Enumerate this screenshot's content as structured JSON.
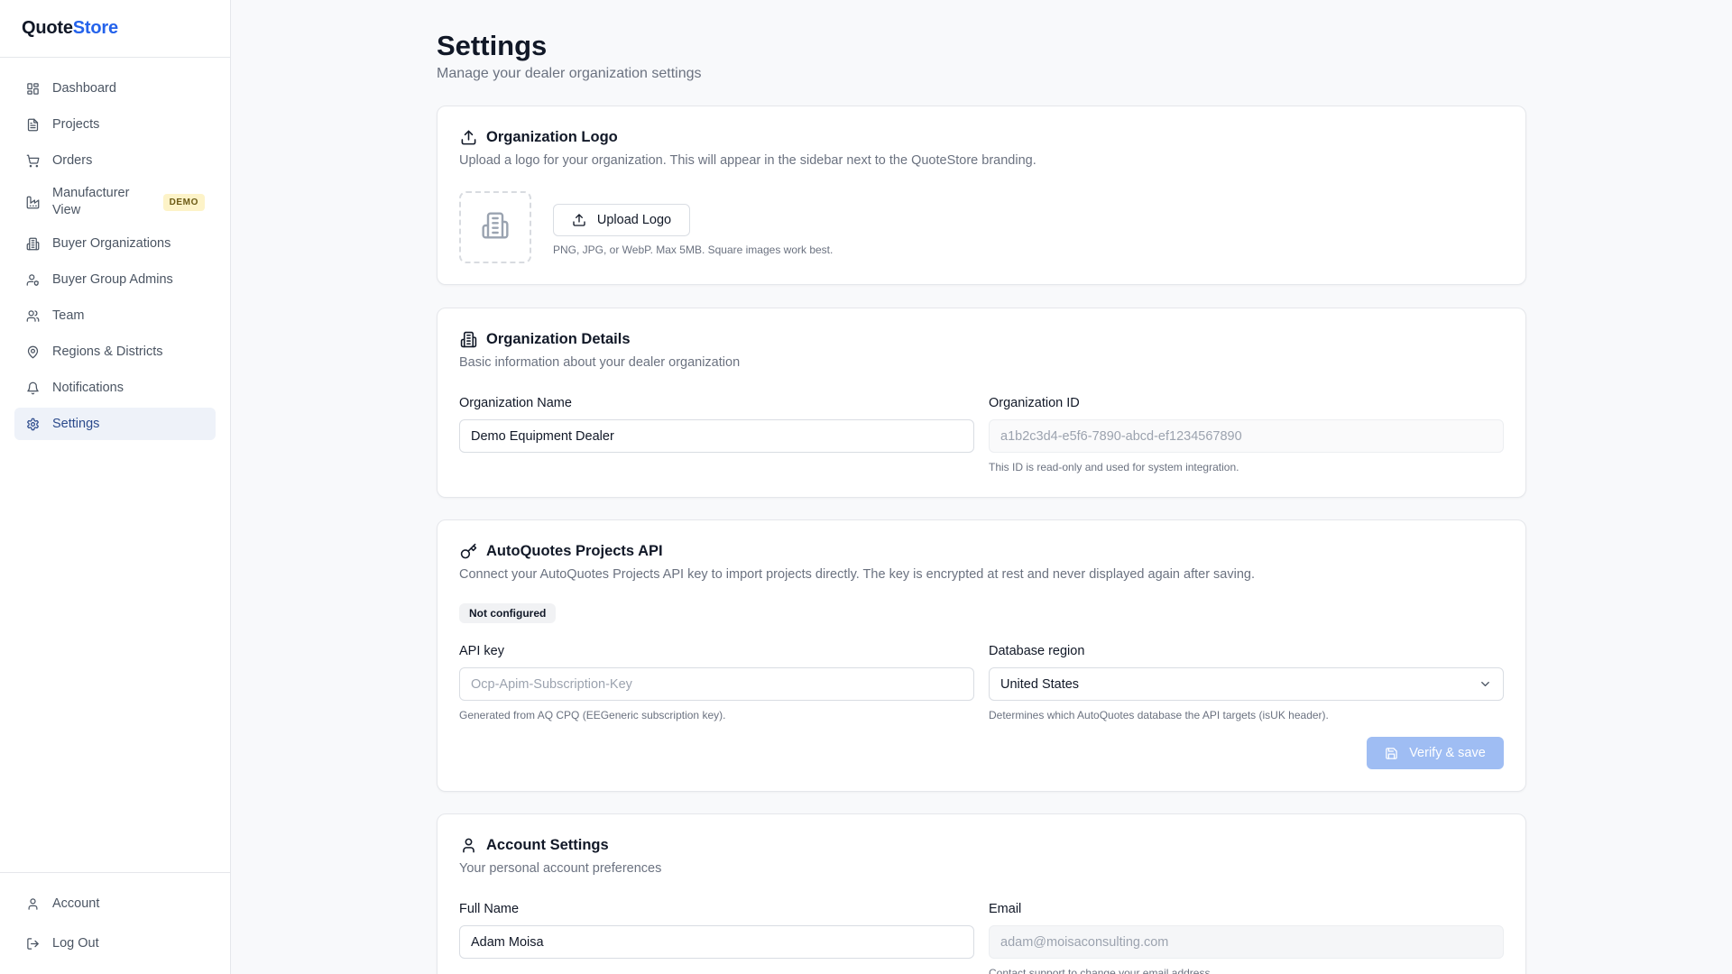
{
  "brand": {
    "part1": "Quote",
    "part2": "Store"
  },
  "sidebar": {
    "items": [
      {
        "label": "Dashboard",
        "icon": "dashboard-icon"
      },
      {
        "label": "Projects",
        "icon": "document-icon"
      },
      {
        "label": "Orders",
        "icon": "cart-icon"
      },
      {
        "label": "Manufacturer View",
        "icon": "factory-icon",
        "badge": "DEMO"
      },
      {
        "label": "Buyer Organizations",
        "icon": "building-icon"
      },
      {
        "label": "Buyer Group Admins",
        "icon": "user-shield-icon"
      },
      {
        "label": "Team",
        "icon": "users-icon"
      },
      {
        "label": "Regions & Districts",
        "icon": "map-pin-icon"
      },
      {
        "label": "Notifications",
        "icon": "bell-icon"
      },
      {
        "label": "Settings",
        "icon": "gear-icon",
        "active": true
      }
    ],
    "bottom": [
      {
        "label": "Account",
        "icon": "user-icon"
      },
      {
        "label": "Log Out",
        "icon": "logout-icon"
      }
    ]
  },
  "page": {
    "title": "Settings",
    "subtitle": "Manage your dealer organization settings"
  },
  "logo_card": {
    "title": "Organization Logo",
    "description": "Upload a logo for your organization. This will appear in the sidebar next to the QuoteStore branding.",
    "button": "Upload Logo",
    "hint": "PNG, JPG, or WebP. Max 5MB. Square images work best."
  },
  "details_card": {
    "title": "Organization Details",
    "description": "Basic information about your dealer organization",
    "name_label": "Organization Name",
    "name_value": "Demo Equipment Dealer",
    "id_label": "Organization ID",
    "id_value": "a1b2c3d4-e5f6-7890-abcd-ef1234567890",
    "id_hint": "This ID is read-only and used for system integration."
  },
  "api_card": {
    "title": "AutoQuotes Projects API",
    "description": "Connect your AutoQuotes Projects API key to import projects directly. The key is encrypted at rest and never displayed again after saving.",
    "status": "Not configured",
    "key_label": "API key",
    "key_placeholder": "Ocp-Apim-Subscription-Key",
    "key_hint": "Generated from AQ CPQ (EEGeneric subscription key).",
    "region_label": "Database region",
    "region_value": "United States",
    "region_hint": "Determines which AutoQuotes database the API targets (isUK header).",
    "button": "Verify & save"
  },
  "account_card": {
    "title": "Account Settings",
    "description": "Your personal account preferences",
    "name_label": "Full Name",
    "name_value": "Adam Moisa",
    "email_label": "Email",
    "email_value": "adam@moisaconsulting.com",
    "email_hint": "Contact support to change your email address."
  },
  "colors": {
    "accent": "#2563eb",
    "active_nav_bg": "#eef2f9",
    "active_nav_text": "#2b4a8c",
    "demo_badge_bg": "#fdf3c8",
    "verify_button": "#9fbdf3"
  }
}
